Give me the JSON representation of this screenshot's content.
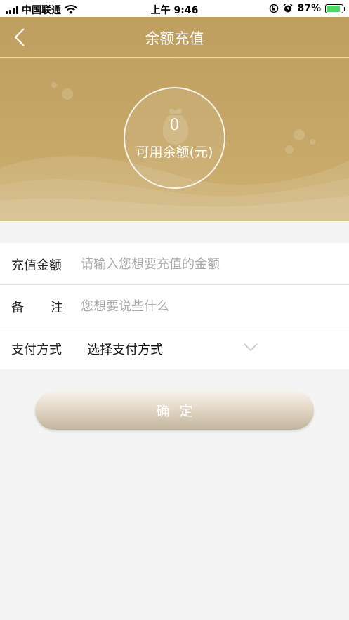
{
  "status_bar": {
    "carrier": "中国联通",
    "time": "上午 9:46",
    "battery_percent": "87%",
    "battery_level": 0.87,
    "icons": [
      "signal-icon",
      "wifi-icon",
      "orientation-lock-icon",
      "alarm-icon",
      "battery-icon"
    ]
  },
  "header": {
    "title": "余额充值",
    "back_icon": "chevron-left-icon"
  },
  "balance": {
    "value": "0",
    "label": "可用余额(元)",
    "icon": "money-bag-icon"
  },
  "form": {
    "amount": {
      "label": "充值金额",
      "value": "",
      "placeholder": "请输入您想要充值的金额"
    },
    "remark": {
      "label": "备注",
      "value": "",
      "placeholder": "您想要说些什么"
    },
    "payment": {
      "label": "支付方式",
      "selected": "选择支付方式",
      "icon": "chevron-down-icon"
    }
  },
  "confirm_label": "确定",
  "colors": {
    "banner": "#c3a365",
    "accent_text": "#ffffff",
    "page_bg": "#f4f4f4",
    "button_gradient_top": "#f6f2e9",
    "button_gradient_bottom": "#c2b49c"
  }
}
